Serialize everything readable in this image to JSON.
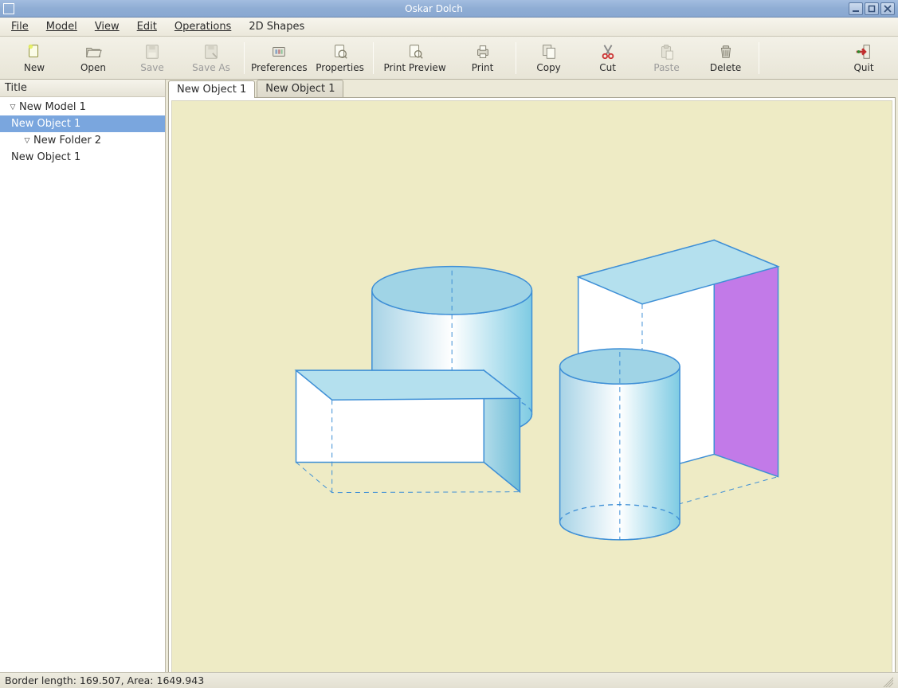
{
  "window": {
    "title": "Oskar Dolch"
  },
  "menu": {
    "file": "File",
    "model": "Model",
    "view": "View",
    "edit": "Edit",
    "operations": "Operations",
    "shapes2d": "2D Shapes"
  },
  "toolbar": {
    "new": "New",
    "open": "Open",
    "save": "Save",
    "save_as": "Save As",
    "preferences": "Preferences",
    "properties": "Properties",
    "print_preview": "Print Preview",
    "print": "Print",
    "copy": "Copy",
    "cut": "Cut",
    "paste": "Paste",
    "delete": "Delete",
    "quit": "Quit"
  },
  "tree": {
    "header": "Title",
    "model": "New Model 1",
    "object1": "New Object 1",
    "folder": "New Folder 2",
    "object2": "New Object 1"
  },
  "tabs": {
    "tab1": "New Object 1",
    "tab2": "New Object 1"
  },
  "status": {
    "text": "Border length: 169.507, Area: 1649.943"
  },
  "icons": {
    "minimize": "minimize-icon",
    "maximize": "maximize-icon",
    "close": "close-icon",
    "new": "new-file-icon",
    "open": "open-folder-icon",
    "save": "save-icon",
    "save_as": "save-as-icon",
    "preferences": "preferences-icon",
    "properties": "properties-icon",
    "print_preview": "print-preview-icon",
    "print": "print-icon",
    "copy": "copy-icon",
    "cut": "cut-icon",
    "paste": "paste-icon",
    "delete": "delete-icon",
    "quit": "quit-icon"
  }
}
